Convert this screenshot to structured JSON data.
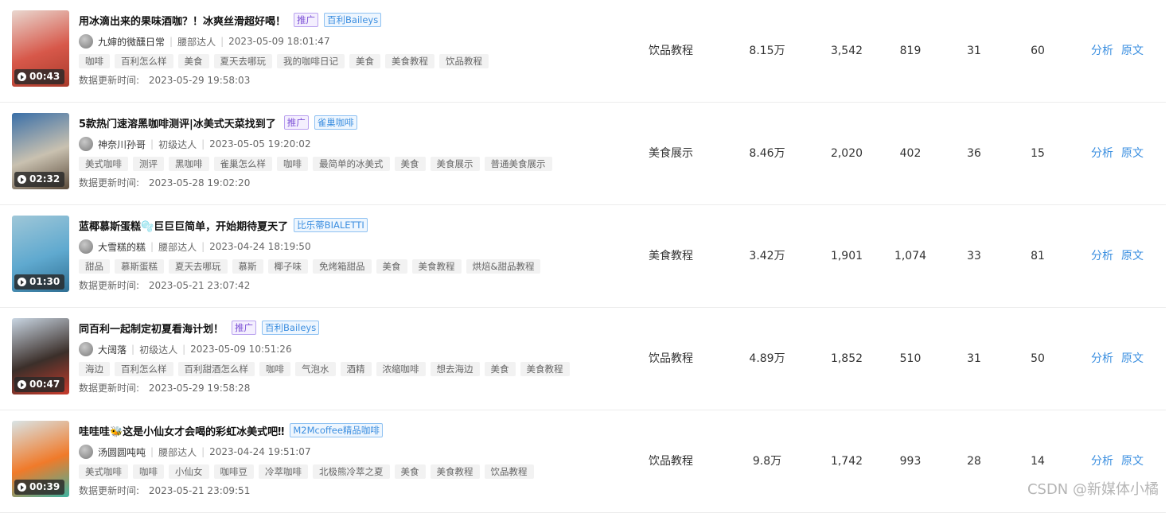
{
  "videos": [
    {
      "title": "用冰滴出来的果味酒咖？！冰爽丝滑超好喝！",
      "promo_label": "推广",
      "brand_label": "百利Baileys",
      "duration": "00:43",
      "author": "九婶的微醺日常",
      "level": "腰部达人",
      "publish_time": "2023-05-09 18:01:47",
      "tags": [
        "咖啡",
        "百利怎么样",
        "美食",
        "夏天去哪玩",
        "我的咖啡日记",
        "美食",
        "美食教程",
        "饮品教程"
      ],
      "update_label": "数据更新时间:",
      "update_time": "2023-05-29 19:58:03",
      "category": "饮品教程",
      "stat_a": "8.15万",
      "stat_b": "3,542",
      "stat_c": "819",
      "stat_d": "31",
      "stat_e": "60",
      "thumb_colors": [
        "#e9d7cf",
        "#d7584a",
        "#a83a2a"
      ]
    },
    {
      "title": "5款热门速溶黑咖啡测评|冰美式天菜找到了",
      "promo_label": "推广",
      "brand_label": "雀巢咖啡",
      "duration": "02:32",
      "author": "神奈川孙哥",
      "level": "初级达人",
      "publish_time": "2023-05-05 19:20:02",
      "tags": [
        "美式咖啡",
        "测评",
        "黑咖啡",
        "雀巢怎么样",
        "咖啡",
        "最简单的冰美式",
        "美食",
        "美食展示",
        "普通美食展示"
      ],
      "update_label": "数据更新时间:",
      "update_time": "2023-05-28 19:02:20",
      "category": "美食展示",
      "stat_a": "8.46万",
      "stat_b": "2,020",
      "stat_c": "402",
      "stat_d": "36",
      "stat_e": "15",
      "thumb_colors": [
        "#3a6fa8",
        "#c9c1b0",
        "#5a4a3a"
      ]
    },
    {
      "title": "蓝椰慕斯蛋糕🫧巨巨巨简单，开始期待夏天了",
      "promo_label": "",
      "brand_label": "比乐蒂BIALETTI",
      "duration": "01:30",
      "author": "大雪糕的糕",
      "level": "腰部达人",
      "publish_time": "2023-04-24 18:19:50",
      "tags": [
        "甜品",
        "慕斯蛋糕",
        "夏天去哪玩",
        "慕斯",
        "椰子味",
        "免烤箱甜品",
        "美食",
        "美食教程",
        "烘焙&甜品教程"
      ],
      "update_label": "数据更新时间:",
      "update_time": "2023-05-21 23:07:42",
      "category": "美食教程",
      "stat_a": "3.42万",
      "stat_b": "1,901",
      "stat_c": "1,074",
      "stat_d": "33",
      "stat_e": "81",
      "thumb_colors": [
        "#9fc7d8",
        "#5fa9cf",
        "#2f6f93"
      ]
    },
    {
      "title": "同百利一起制定初夏看海计划！",
      "promo_label": "推广",
      "brand_label": "百利Baileys",
      "duration": "00:47",
      "author": "大阔落",
      "level": "初级达人",
      "publish_time": "2023-05-09 10:51:26",
      "tags": [
        "海边",
        "百利怎么样",
        "百利甜酒怎么样",
        "咖啡",
        "气泡水",
        "酒精",
        "浓缩咖啡",
        "想去海边",
        "美食",
        "美食教程"
      ],
      "update_label": "数据更新时间:",
      "update_time": "2023-05-29 19:58:28",
      "category": "饮品教程",
      "stat_a": "4.89万",
      "stat_b": "1,852",
      "stat_c": "510",
      "stat_d": "31",
      "stat_e": "50",
      "thumb_colors": [
        "#c9d6e3",
        "#3b2f2a",
        "#c83b2c"
      ]
    },
    {
      "title": "哇哇哇🐝这是小仙女才会喝的彩虹冰美式吧‼",
      "promo_label": "",
      "brand_label": "M2Mcoffee精品咖啡",
      "duration": "00:39",
      "author": "汤圆圆吨吨",
      "level": "腰部达人",
      "publish_time": "2023-04-24 19:51:07",
      "tags": [
        "美式咖啡",
        "咖啡",
        "小仙女",
        "咖啡豆",
        "冷萃咖啡",
        "北极熊冷萃之夏",
        "美食",
        "美食教程",
        "饮品教程"
      ],
      "update_label": "数据更新时间:",
      "update_time": "2023-05-21 23:09:51",
      "category": "饮品教程",
      "stat_a": "9.8万",
      "stat_b": "1,742",
      "stat_c": "993",
      "stat_d": "28",
      "stat_e": "14",
      "thumb_colors": [
        "#d9e4e6",
        "#f07a2a",
        "#3fb3a0"
      ]
    }
  ],
  "actions": {
    "analyze": "分析",
    "original": "原文"
  },
  "watermark": "CSDN @新媒体小橘",
  "colors": {
    "link": "#3b8fe0",
    "promo": "#7b4fd6",
    "brand": "#3d8fe0"
  }
}
